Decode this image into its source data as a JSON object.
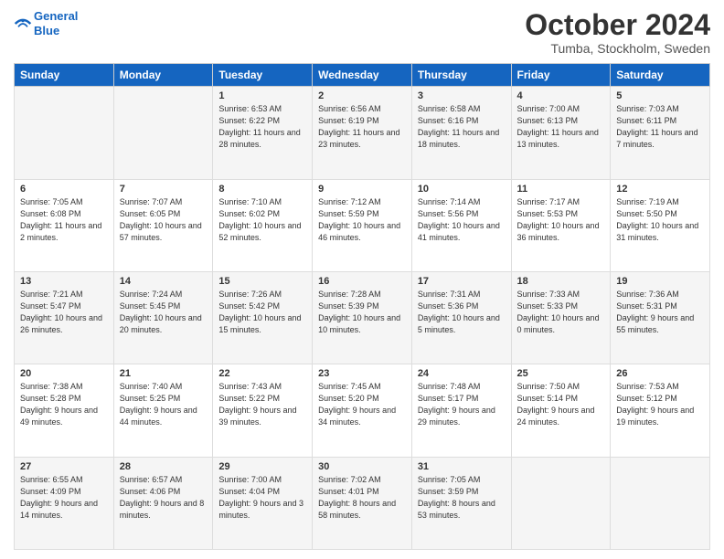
{
  "logo": {
    "line1": "General",
    "line2": "Blue"
  },
  "title": "October 2024",
  "subtitle": "Tumba, Stockholm, Sweden",
  "header_days": [
    "Sunday",
    "Monday",
    "Tuesday",
    "Wednesday",
    "Thursday",
    "Friday",
    "Saturday"
  ],
  "weeks": [
    [
      {
        "day": "",
        "sunrise": "",
        "sunset": "",
        "daylight": ""
      },
      {
        "day": "",
        "sunrise": "",
        "sunset": "",
        "daylight": ""
      },
      {
        "day": "1",
        "sunrise": "Sunrise: 6:53 AM",
        "sunset": "Sunset: 6:22 PM",
        "daylight": "Daylight: 11 hours and 28 minutes."
      },
      {
        "day": "2",
        "sunrise": "Sunrise: 6:56 AM",
        "sunset": "Sunset: 6:19 PM",
        "daylight": "Daylight: 11 hours and 23 minutes."
      },
      {
        "day": "3",
        "sunrise": "Sunrise: 6:58 AM",
        "sunset": "Sunset: 6:16 PM",
        "daylight": "Daylight: 11 hours and 18 minutes."
      },
      {
        "day": "4",
        "sunrise": "Sunrise: 7:00 AM",
        "sunset": "Sunset: 6:13 PM",
        "daylight": "Daylight: 11 hours and 13 minutes."
      },
      {
        "day": "5",
        "sunrise": "Sunrise: 7:03 AM",
        "sunset": "Sunset: 6:11 PM",
        "daylight": "Daylight: 11 hours and 7 minutes."
      }
    ],
    [
      {
        "day": "6",
        "sunrise": "Sunrise: 7:05 AM",
        "sunset": "Sunset: 6:08 PM",
        "daylight": "Daylight: 11 hours and 2 minutes."
      },
      {
        "day": "7",
        "sunrise": "Sunrise: 7:07 AM",
        "sunset": "Sunset: 6:05 PM",
        "daylight": "Daylight: 10 hours and 57 minutes."
      },
      {
        "day": "8",
        "sunrise": "Sunrise: 7:10 AM",
        "sunset": "Sunset: 6:02 PM",
        "daylight": "Daylight: 10 hours and 52 minutes."
      },
      {
        "day": "9",
        "sunrise": "Sunrise: 7:12 AM",
        "sunset": "Sunset: 5:59 PM",
        "daylight": "Daylight: 10 hours and 46 minutes."
      },
      {
        "day": "10",
        "sunrise": "Sunrise: 7:14 AM",
        "sunset": "Sunset: 5:56 PM",
        "daylight": "Daylight: 10 hours and 41 minutes."
      },
      {
        "day": "11",
        "sunrise": "Sunrise: 7:17 AM",
        "sunset": "Sunset: 5:53 PM",
        "daylight": "Daylight: 10 hours and 36 minutes."
      },
      {
        "day": "12",
        "sunrise": "Sunrise: 7:19 AM",
        "sunset": "Sunset: 5:50 PM",
        "daylight": "Daylight: 10 hours and 31 minutes."
      }
    ],
    [
      {
        "day": "13",
        "sunrise": "Sunrise: 7:21 AM",
        "sunset": "Sunset: 5:47 PM",
        "daylight": "Daylight: 10 hours and 26 minutes."
      },
      {
        "day": "14",
        "sunrise": "Sunrise: 7:24 AM",
        "sunset": "Sunset: 5:45 PM",
        "daylight": "Daylight: 10 hours and 20 minutes."
      },
      {
        "day": "15",
        "sunrise": "Sunrise: 7:26 AM",
        "sunset": "Sunset: 5:42 PM",
        "daylight": "Daylight: 10 hours and 15 minutes."
      },
      {
        "day": "16",
        "sunrise": "Sunrise: 7:28 AM",
        "sunset": "Sunset: 5:39 PM",
        "daylight": "Daylight: 10 hours and 10 minutes."
      },
      {
        "day": "17",
        "sunrise": "Sunrise: 7:31 AM",
        "sunset": "Sunset: 5:36 PM",
        "daylight": "Daylight: 10 hours and 5 minutes."
      },
      {
        "day": "18",
        "sunrise": "Sunrise: 7:33 AM",
        "sunset": "Sunset: 5:33 PM",
        "daylight": "Daylight: 10 hours and 0 minutes."
      },
      {
        "day": "19",
        "sunrise": "Sunrise: 7:36 AM",
        "sunset": "Sunset: 5:31 PM",
        "daylight": "Daylight: 9 hours and 55 minutes."
      }
    ],
    [
      {
        "day": "20",
        "sunrise": "Sunrise: 7:38 AM",
        "sunset": "Sunset: 5:28 PM",
        "daylight": "Daylight: 9 hours and 49 minutes."
      },
      {
        "day": "21",
        "sunrise": "Sunrise: 7:40 AM",
        "sunset": "Sunset: 5:25 PM",
        "daylight": "Daylight: 9 hours and 44 minutes."
      },
      {
        "day": "22",
        "sunrise": "Sunrise: 7:43 AM",
        "sunset": "Sunset: 5:22 PM",
        "daylight": "Daylight: 9 hours and 39 minutes."
      },
      {
        "day": "23",
        "sunrise": "Sunrise: 7:45 AM",
        "sunset": "Sunset: 5:20 PM",
        "daylight": "Daylight: 9 hours and 34 minutes."
      },
      {
        "day": "24",
        "sunrise": "Sunrise: 7:48 AM",
        "sunset": "Sunset: 5:17 PM",
        "daylight": "Daylight: 9 hours and 29 minutes."
      },
      {
        "day": "25",
        "sunrise": "Sunrise: 7:50 AM",
        "sunset": "Sunset: 5:14 PM",
        "daylight": "Daylight: 9 hours and 24 minutes."
      },
      {
        "day": "26",
        "sunrise": "Sunrise: 7:53 AM",
        "sunset": "Sunset: 5:12 PM",
        "daylight": "Daylight: 9 hours and 19 minutes."
      }
    ],
    [
      {
        "day": "27",
        "sunrise": "Sunrise: 6:55 AM",
        "sunset": "Sunset: 4:09 PM",
        "daylight": "Daylight: 9 hours and 14 minutes."
      },
      {
        "day": "28",
        "sunrise": "Sunrise: 6:57 AM",
        "sunset": "Sunset: 4:06 PM",
        "daylight": "Daylight: 9 hours and 8 minutes."
      },
      {
        "day": "29",
        "sunrise": "Sunrise: 7:00 AM",
        "sunset": "Sunset: 4:04 PM",
        "daylight": "Daylight: 9 hours and 3 minutes."
      },
      {
        "day": "30",
        "sunrise": "Sunrise: 7:02 AM",
        "sunset": "Sunset: 4:01 PM",
        "daylight": "Daylight: 8 hours and 58 minutes."
      },
      {
        "day": "31",
        "sunrise": "Sunrise: 7:05 AM",
        "sunset": "Sunset: 3:59 PM",
        "daylight": "Daylight: 8 hours and 53 minutes."
      },
      {
        "day": "",
        "sunrise": "",
        "sunset": "",
        "daylight": ""
      },
      {
        "day": "",
        "sunrise": "",
        "sunset": "",
        "daylight": ""
      }
    ]
  ]
}
